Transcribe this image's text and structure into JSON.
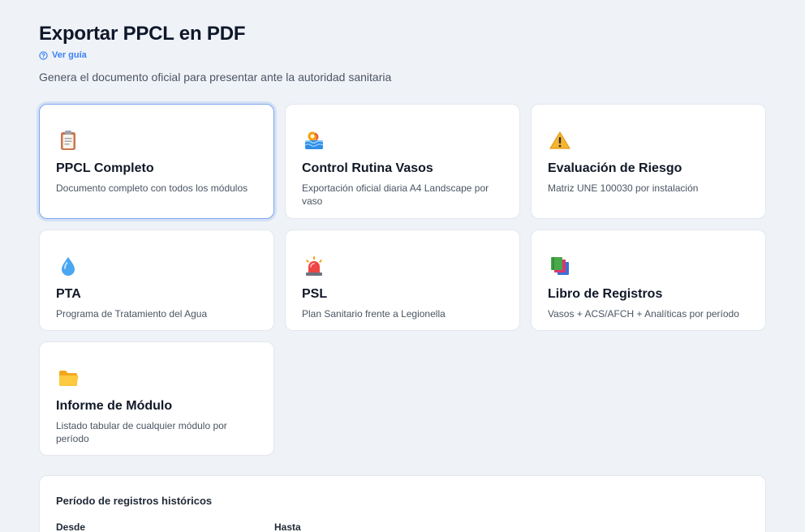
{
  "header": {
    "title": "Exportar PPCL en PDF",
    "guide_label": "Ver guía",
    "subtitle": "Genera el documento oficial para presentar ante la autoridad sanitaria"
  },
  "cards": [
    {
      "title": "PPCL Completo",
      "description": "Documento completo con todos los módulos",
      "icon": "clipboard-icon",
      "selected": true
    },
    {
      "title": "Control Rutina Vasos",
      "description": "Exportación oficial diaria A4 Landscape por vaso",
      "icon": "pool-icon",
      "selected": false
    },
    {
      "title": "Evaluación de Riesgo",
      "description": "Matriz UNE 100030 por instalación",
      "icon": "warning-icon",
      "selected": false
    },
    {
      "title": "PTA",
      "description": "Programa de Tratamiento del Agua",
      "icon": "water-drop-icon",
      "selected": false
    },
    {
      "title": "PSL",
      "description": "Plan Sanitario frente a Legionella",
      "icon": "siren-icon",
      "selected": false
    },
    {
      "title": "Libro de Registros",
      "description": "Vasos + ACS/AFCH + Analíticas por período",
      "icon": "books-icon",
      "selected": false
    },
    {
      "title": "Informe de Módulo",
      "description": "Listado tabular de cualquier módulo por período",
      "icon": "folder-icon",
      "selected": false
    }
  ],
  "period": {
    "title": "Período de registros históricos",
    "from_label": "Desde",
    "to_label": "Hasta"
  },
  "colors": {
    "background": "#eff2f7",
    "accent": "#3b82f6",
    "selected_border": "#7aa7ee"
  }
}
